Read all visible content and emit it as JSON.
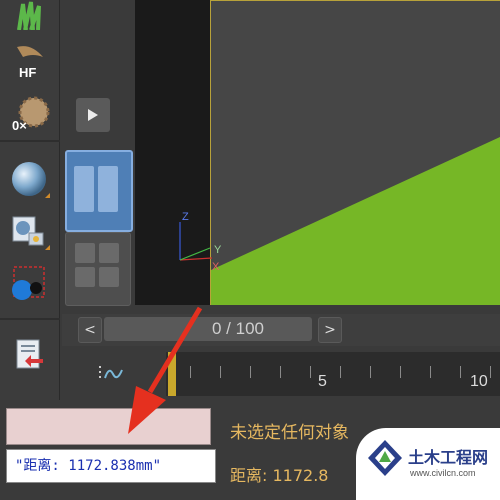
{
  "toolbar": {
    "tools": [
      {
        "icon": "grass-icon"
      },
      {
        "icon": "hair-fur-icon",
        "label": "HF"
      },
      {
        "icon": "clear-material-icon",
        "label": "0×"
      },
      {
        "icon": "sphere-material-icon"
      },
      {
        "icon": "render-setup-icon"
      },
      {
        "icon": "object-select-icon"
      },
      {
        "icon": "import-icon"
      }
    ]
  },
  "view_panel": {
    "play_button_icon": "play-icon",
    "layouts": [
      {
        "icon": "two-pane-layout-icon",
        "selected": true
      },
      {
        "icon": "four-pane-layout-icon",
        "selected": false
      }
    ]
  },
  "viewport": {
    "axis_labels": {
      "z": "Z",
      "y": "Y",
      "x": "X"
    },
    "plane_color": "#76b726"
  },
  "time_slider": {
    "prev_label": "<",
    "next_label": ">",
    "frame_text": "0 / 100"
  },
  "trackbar": {
    "curve_icon": "curve-editor-icon",
    "tick_labels": [
      "5",
      "10"
    ]
  },
  "status": {
    "listener_text": "\"距离: 1172.838mm\"",
    "prompt_text": "未选定任何对象",
    "distance_text": "距离: 1172.8"
  },
  "watermark": {
    "name": "土木工程网",
    "url": "www.civilcn.com"
  },
  "colors": {
    "arrow": "#e5301f",
    "accent": "#d08a2a",
    "prompt": "#e6b860",
    "listener": "#1a2fb0"
  }
}
